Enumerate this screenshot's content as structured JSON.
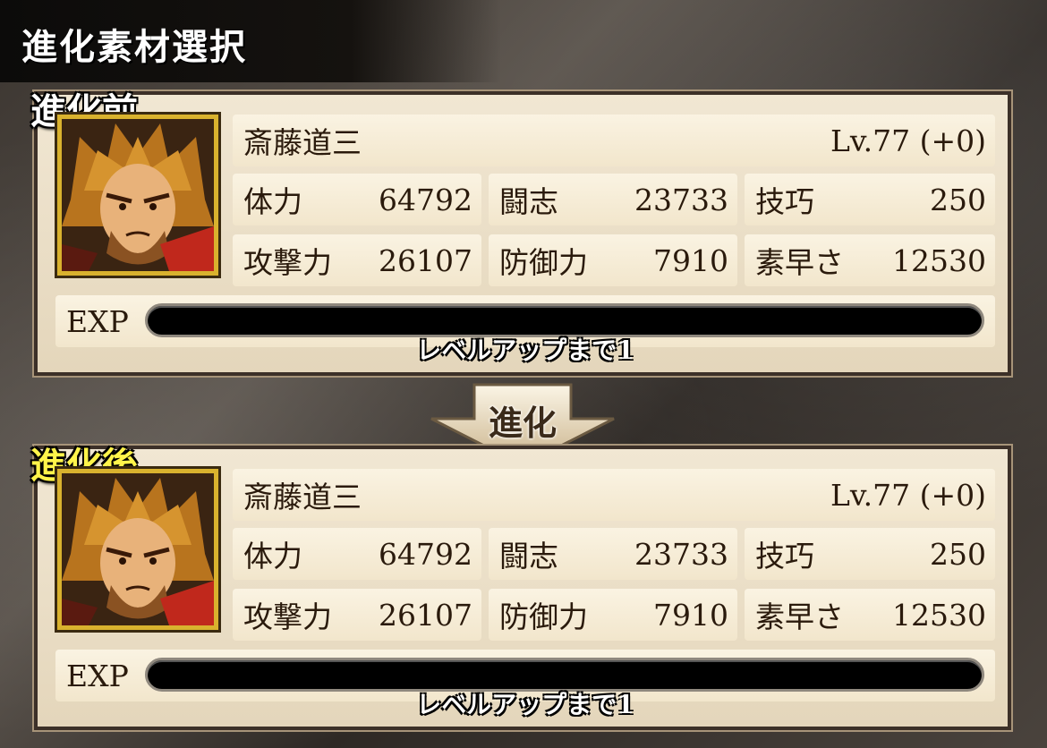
{
  "header": {
    "title": "進化素材選択"
  },
  "before": {
    "label": "進化前",
    "name": "斎藤道三",
    "level": "Lv.77 (+0)",
    "stats": [
      {
        "label": "体力",
        "value": "64792"
      },
      {
        "label": "闘志",
        "value": "23733"
      },
      {
        "label": "技巧",
        "value": "250"
      },
      {
        "label": "攻撃力",
        "value": "26107"
      },
      {
        "label": "防御力",
        "value": "7910"
      },
      {
        "label": "素早さ",
        "value": "12530"
      }
    ],
    "exp_label": "EXP",
    "exp_fill": 0,
    "exp_caption": "レベルアップまで1"
  },
  "evolve_arrow": {
    "label": "進化"
  },
  "after": {
    "label": "進化後",
    "name": "斎藤道三",
    "level": "Lv.77 (+0)",
    "stats": [
      {
        "label": "体力",
        "value": "64792"
      },
      {
        "label": "闘志",
        "value": "23733"
      },
      {
        "label": "技巧",
        "value": "250"
      },
      {
        "label": "攻撃力",
        "value": "26107"
      },
      {
        "label": "防御力",
        "value": "7910"
      },
      {
        "label": "素早さ",
        "value": "12530"
      }
    ],
    "exp_label": "EXP",
    "exp_fill": 0,
    "exp_caption": "レベルアップまで1"
  },
  "colors": {
    "frame_gold": "#d9b22e",
    "after_label": "#fff44a",
    "card_bg": "#f1e7d3"
  },
  "icons": {
    "portrait": "samurai-portrait-icon",
    "arrow": "down-arrow-icon"
  }
}
